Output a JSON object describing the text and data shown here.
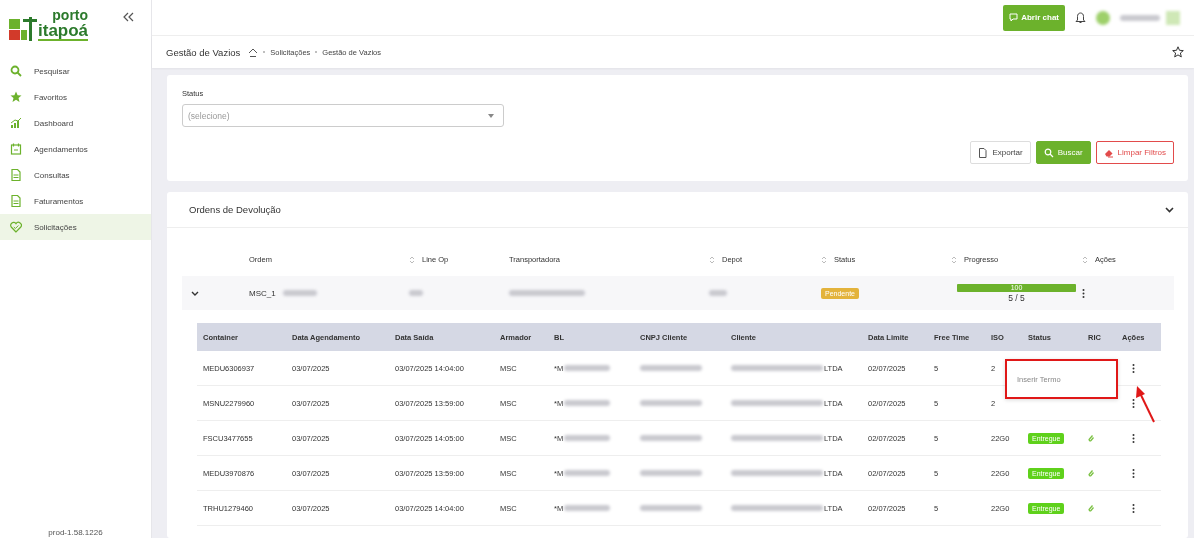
{
  "logo": {
    "top": "porto",
    "bottom": "itapoá"
  },
  "sidebar": {
    "items": [
      {
        "label": "Pesquisar",
        "selected": false
      },
      {
        "label": "Favoritos",
        "selected": false
      },
      {
        "label": "Dashboard",
        "selected": false
      },
      {
        "label": "Agendamentos",
        "selected": false
      },
      {
        "label": "Consultas",
        "selected": false
      },
      {
        "label": "Faturamentos",
        "selected": false
      },
      {
        "label": "Solicitações",
        "selected": true
      }
    ],
    "version": "prod-1.58.1226"
  },
  "topbar": {
    "chat_button": "Abrir chat"
  },
  "breadcrumb": {
    "title": "Gestão de Vazios",
    "items": [
      "Solicitações",
      "Gestão de Vazios"
    ]
  },
  "filters": {
    "status_label": "Status",
    "status_placeholder": "(selecione)",
    "buttons": [
      {
        "label": "Exportar",
        "kind": "export"
      },
      {
        "label": "Buscar",
        "kind": "search"
      },
      {
        "label": "Limpar Filtros",
        "kind": "clear"
      }
    ]
  },
  "orders": {
    "title": "Ordens de Devolução",
    "expanded": true,
    "columns": [
      {
        "label": "Ordem",
        "sortable": false
      },
      {
        "label": "Line Op",
        "sortable": true
      },
      {
        "label": "Transportadora",
        "sortable": false
      },
      {
        "label": "Depot",
        "sortable": true
      },
      {
        "label": "Status",
        "sortable": true
      },
      {
        "label": "Progresso",
        "sortable": true
      },
      {
        "label": "Ações",
        "sortable": true
      }
    ],
    "rows": [
      {
        "expanded": true,
        "order": "MSC_1",
        "status": "Pendente",
        "progress_label": "100",
        "level": 1,
        "progress_text": "5 / 5"
      }
    ],
    "detail": {
      "columns": [
        "Container",
        "Data Agendamento",
        "Data Saída",
        "Armador",
        "BL",
        "CNPJ Cliente",
        "Cliente",
        "Data Limite",
        "Free Time",
        "ISO",
        "Status",
        "RIC",
        "Ações"
      ],
      "rows": [
        {
          "container": "MEDU6306937",
          "scheduled": "03/07/2025",
          "exit": "03/07/2025 14:04:00",
          "carrier": "MSC",
          "bl": "*M",
          "client": "LTDA",
          "limit": "02/07/2025",
          "free_time": "5",
          "iso": "2",
          "menu_open": true
        },
        {
          "container": "MSNU2279960",
          "scheduled": "03/07/2025",
          "exit": "03/07/2025 13:59:00",
          "carrier": "MSC",
          "bl": "*M",
          "client": "LTDA",
          "limit": "02/07/2025",
          "free_time": "5",
          "iso": "2"
        },
        {
          "container": "FSCU3477655",
          "scheduled": "03/07/2025",
          "exit": "03/07/2025 14:05:00",
          "carrier": "MSC",
          "bl": "*M",
          "client": "LTDA",
          "limit": "02/07/2025",
          "free_time": "5",
          "iso": "22G0",
          "status": "Entregue",
          "ric": true
        },
        {
          "container": "MEDU3970876",
          "scheduled": "03/07/2025",
          "exit": "03/07/2025 13:59:00",
          "carrier": "MSC",
          "bl": "*M",
          "client": "LTDA",
          "limit": "02/07/2025",
          "free_time": "5",
          "iso": "22G0",
          "status": "Entregue",
          "ric": true
        },
        {
          "container": "TRHU1279460",
          "scheduled": "03/07/2025",
          "exit": "03/07/2025 14:04:00",
          "carrier": "MSC",
          "bl": "*M",
          "client": "LTDA",
          "limit": "02/07/2025",
          "free_time": "5",
          "iso": "22G0",
          "status": "Entregue",
          "ric": true
        }
      ],
      "menu_items": [
        "Inserir Termo"
      ]
    }
  },
  "annotations": {
    "highlight": true,
    "arrow": true
  }
}
